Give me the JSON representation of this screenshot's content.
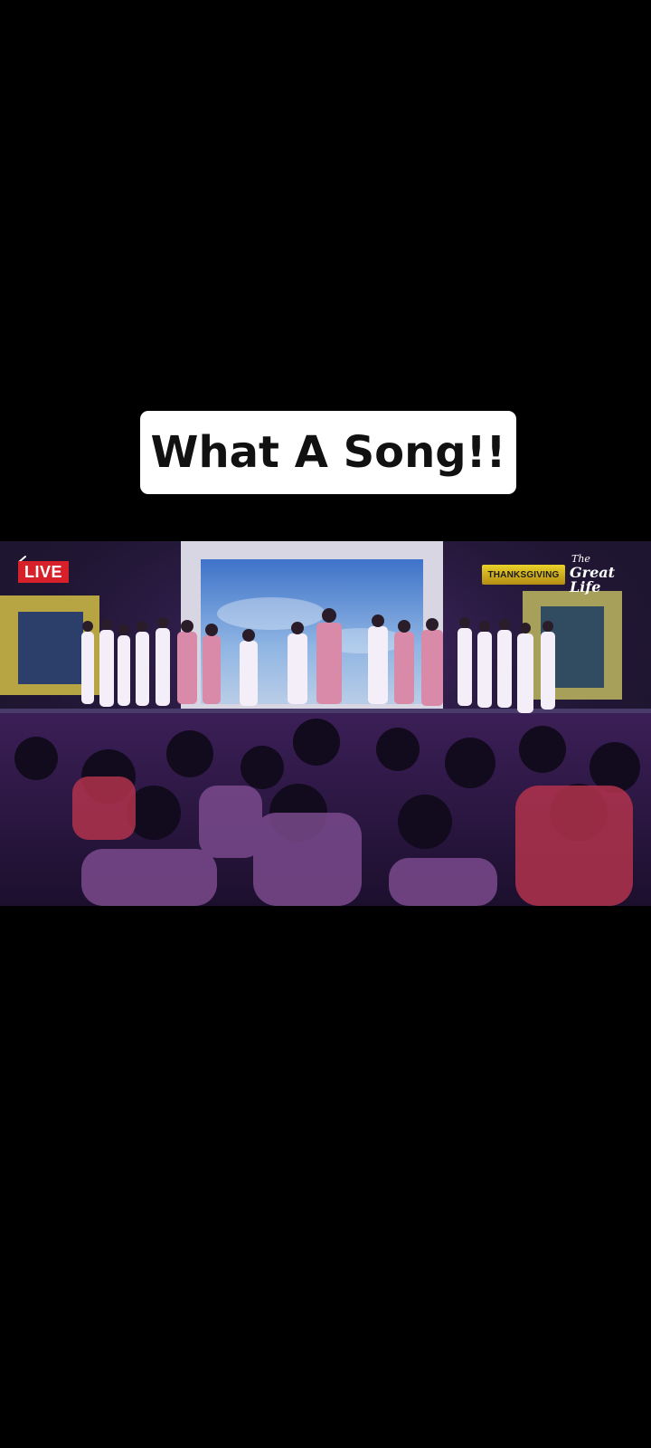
{
  "caption": {
    "text": "What A Song!!"
  },
  "video": {
    "live_badge": "LIVE",
    "event_logo": "THANKSGIVING",
    "brand_logo": {
      "line1": "The",
      "line2": "Great Life"
    },
    "back_icon": "back-arrow-icon"
  },
  "colors": {
    "background": "#000000",
    "caption_bg": "#ffffff",
    "live_red": "#d6202a"
  }
}
